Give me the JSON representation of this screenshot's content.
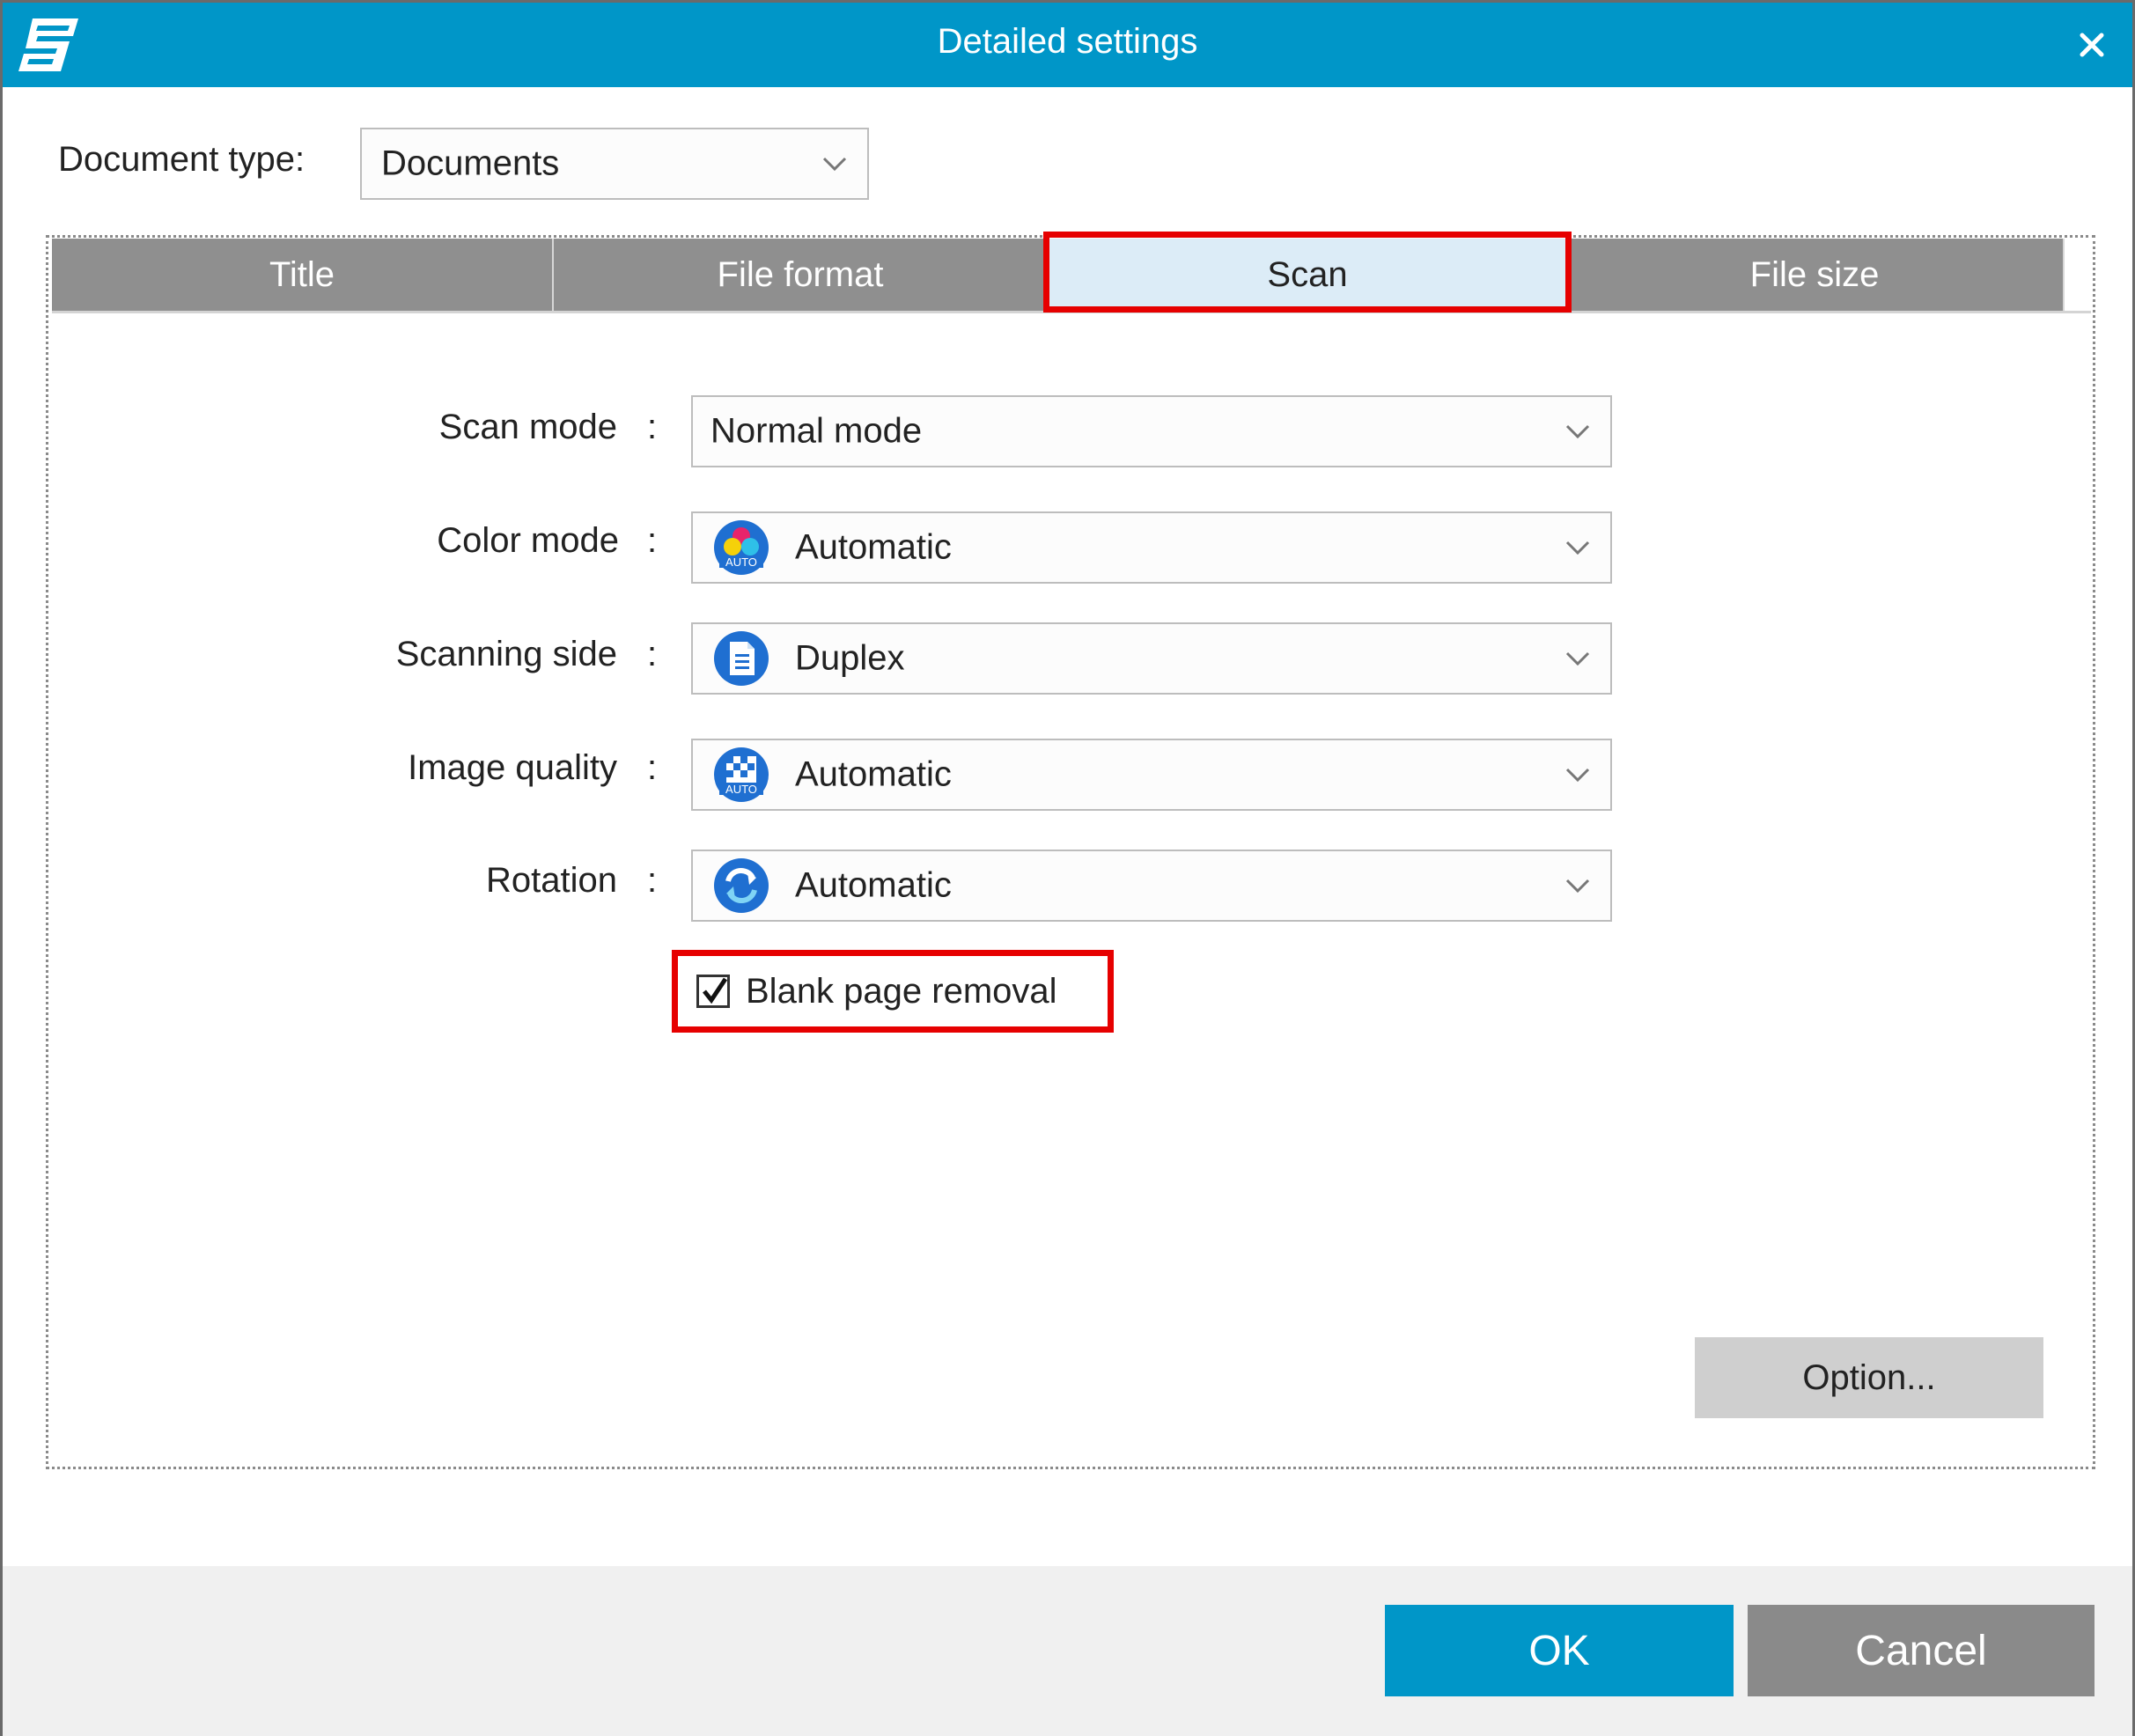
{
  "window": {
    "title": "Detailed settings",
    "logo_icon": "scansnap-s-logo-icon",
    "close_icon": "close-icon"
  },
  "document_type": {
    "label": "Document type:",
    "value": "Documents"
  },
  "tabs": [
    {
      "label": "Title",
      "selected": false
    },
    {
      "label": "File format",
      "selected": false
    },
    {
      "label": "Scan",
      "selected": true
    },
    {
      "label": "File size",
      "selected": false
    }
  ],
  "scan": {
    "colon": ":",
    "rows": [
      {
        "label": "Scan mode",
        "value": "Normal mode",
        "icon": ""
      },
      {
        "label": "Color mode",
        "value": "Automatic",
        "icon": "color-auto-icon"
      },
      {
        "label": "Scanning side",
        "value": "Duplex",
        "icon": "duplex-page-icon"
      },
      {
        "label": "Image quality",
        "value": "Automatic",
        "icon": "quality-auto-icon"
      },
      {
        "label": "Rotation",
        "value": "Automatic",
        "icon": "rotation-icon"
      }
    ],
    "blank_page_removal": {
      "label": "Blank page removal",
      "checked": true
    },
    "option_button": "Option..."
  },
  "footer": {
    "ok": "OK",
    "cancel": "Cancel"
  },
  "colors": {
    "accent": "#0096c8",
    "highlight": "#e60000",
    "tab_inactive": "#8f8f8f",
    "tab_active": "#dcecf7"
  }
}
